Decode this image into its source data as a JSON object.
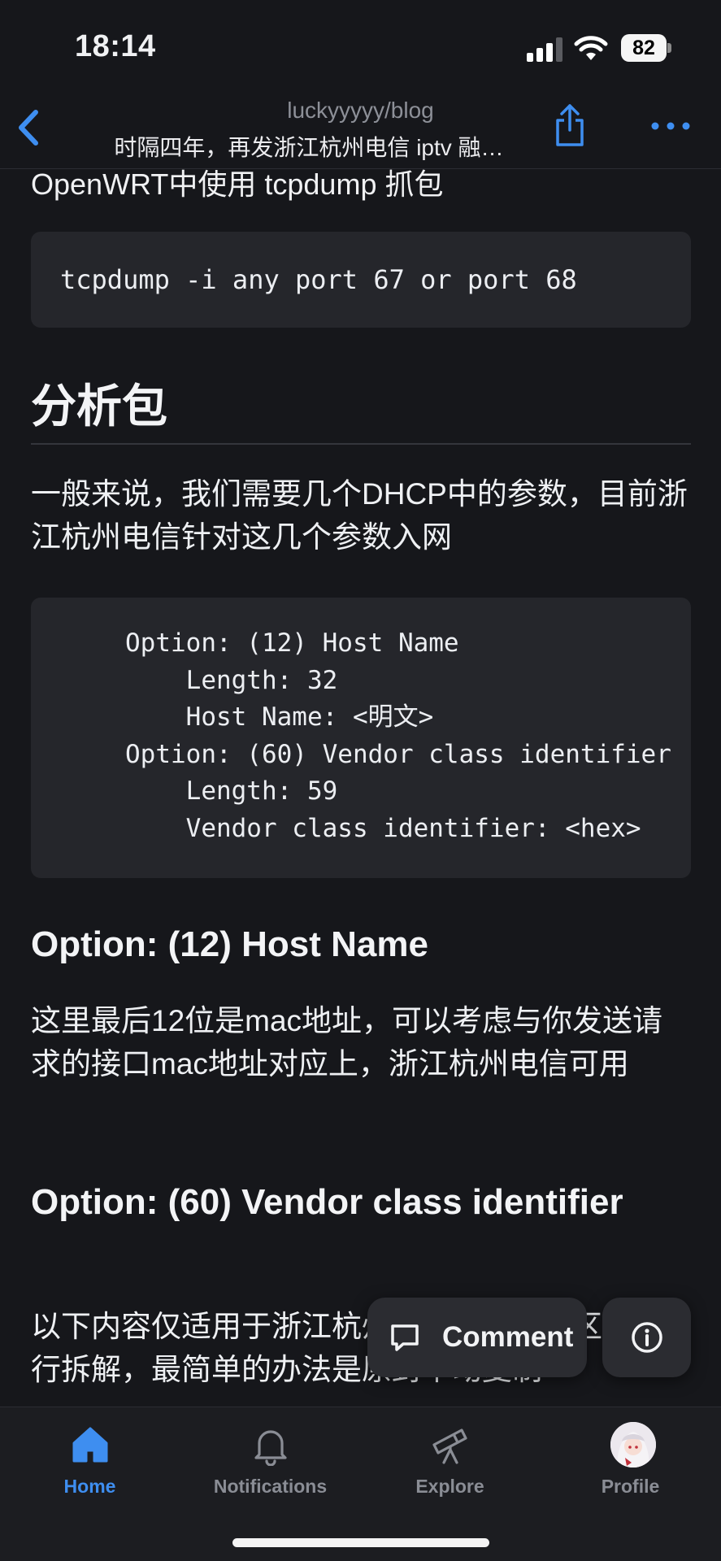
{
  "status_bar": {
    "time": "18:14",
    "battery": "82"
  },
  "header": {
    "repo": "luckyyyyy/blog",
    "title": "时隔四年，再发浙江杭州电信 iptv 融…"
  },
  "article": {
    "partial_heading": "OpenWRT中使用 tcpdump 抓包",
    "code1": "tcpdump -i any port 67 or port 68",
    "h1": "分析包",
    "p1": "一般来说，我们需要几个DHCP中的参数，目前浙江杭州电信针对这几个参数入网",
    "code2": "Option: (12) Host Name\n    Length: 32\n    Host Name: <明文>\nOption: (60) Vendor class identifier\n    Length: 59\n    Vendor class identifier: <hex>",
    "h3a": "Option: (12) Host Name",
    "p2": "这里最后12位是mac地址，可以考虑与你发送请求的接口mac地址对应上，浙江杭州电信可用",
    "h3b": "Option: (60) Vendor class identifier",
    "p3": "以下内容仅适用于浙江杭州电信，其他地区请自行拆解，最简单的办法是原封不动复制"
  },
  "floating": {
    "comment_label": "Comment"
  },
  "tabs": [
    {
      "label": "Home",
      "icon": "home-icon",
      "active": true
    },
    {
      "label": "Notifications",
      "icon": "bell-icon",
      "active": false
    },
    {
      "label": "Explore",
      "icon": "telescope-icon",
      "active": false
    },
    {
      "label": "Profile",
      "icon": "avatar",
      "active": false
    }
  ],
  "colors": {
    "background": "#16171b",
    "accent": "#3e8ef0",
    "code_background": "#25262b"
  }
}
